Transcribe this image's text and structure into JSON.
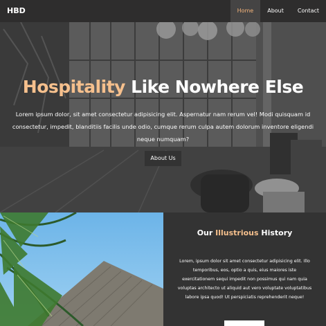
{
  "nav": {
    "brand": "HBD",
    "links": [
      {
        "label": "Home",
        "active": true
      },
      {
        "label": "About",
        "active": false
      },
      {
        "label": "Contact",
        "active": false
      }
    ]
  },
  "hero": {
    "title_accent": "Hospitality",
    "title_rest": " Like Nowhere Else",
    "text": "Lorem ipsum dolor, sit amet consectetur adipisicing elit. Aspernatur nam rerum vel! Modi quisquam id consectetur, impedit, blanditiis facilis unde odio, cumque rerum culpa autem dolorum inventore eligendi neque numquam?",
    "button": "About Us"
  },
  "history": {
    "title_prefix": "Our ",
    "title_accent": "Illustrious",
    "title_suffix": " History",
    "text": "Lorem, ipsum dolor sit amet consectetur adipisicing elit. Illo temporibus, eos, optio a quis, eius maiores iste exercitationem sequi impedit non possimus qui nam quia voluptas architecto ut aliquid aut vero voluptate voluptatibus labore ipsa quod! Ut perspiciatis reprehenderit neque!"
  },
  "colors": {
    "accent": "#f6c08d",
    "nav_active": "#f2b27a",
    "dark": "#333333"
  }
}
